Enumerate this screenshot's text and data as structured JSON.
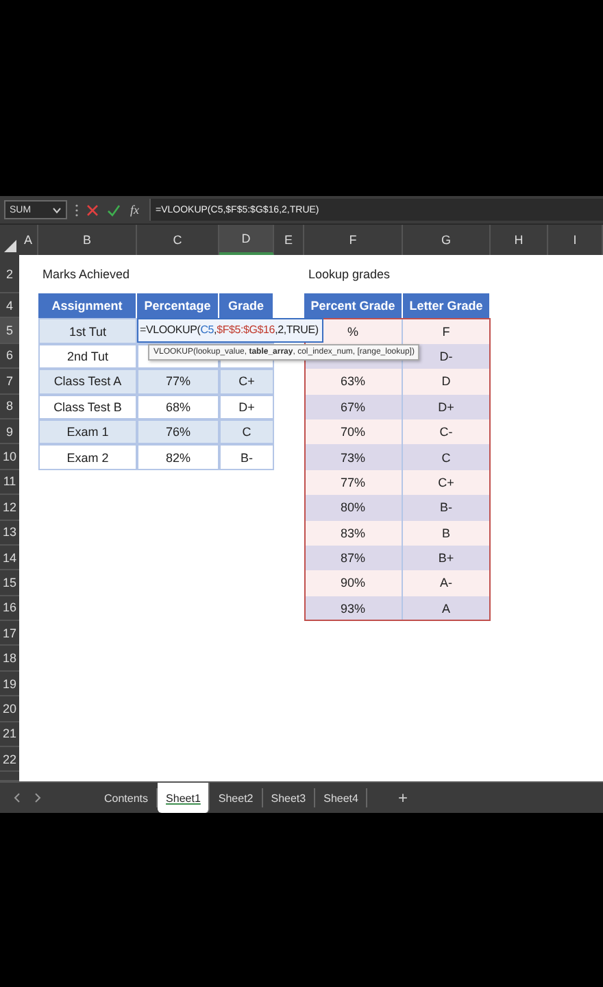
{
  "formula_bar": {
    "name_box": "SUM",
    "function_label": "fx",
    "formula": "=VLOOKUP(C5,$F$5:$G$16,2,TRUE)"
  },
  "columns": [
    {
      "label": "A",
      "selected": false
    },
    {
      "label": "B",
      "selected": false
    },
    {
      "label": "C",
      "selected": false
    },
    {
      "label": "D",
      "selected": true
    },
    {
      "label": "E",
      "selected": false
    },
    {
      "label": "F",
      "selected": false
    },
    {
      "label": "G",
      "selected": false
    },
    {
      "label": "H",
      "selected": false
    },
    {
      "label": "I",
      "selected": false
    }
  ],
  "row_headers": [
    {
      "label": "2",
      "selected": false
    },
    {
      "label": "4",
      "selected": false
    },
    {
      "label": "5",
      "selected": true
    },
    {
      "label": "6",
      "selected": false
    },
    {
      "label": "7",
      "selected": false
    },
    {
      "label": "8",
      "selected": false
    },
    {
      "label": "9",
      "selected": false
    },
    {
      "label": "10",
      "selected": false
    },
    {
      "label": "11",
      "selected": false
    },
    {
      "label": "12",
      "selected": false
    },
    {
      "label": "13",
      "selected": false
    },
    {
      "label": "14",
      "selected": false
    },
    {
      "label": "15",
      "selected": false
    },
    {
      "label": "16",
      "selected": false
    },
    {
      "label": "17",
      "selected": false
    },
    {
      "label": "18",
      "selected": false
    },
    {
      "label": "19",
      "selected": false
    },
    {
      "label": "20",
      "selected": false
    },
    {
      "label": "21",
      "selected": false
    },
    {
      "label": "22",
      "selected": false
    }
  ],
  "marks_table": {
    "title": "Marks Achieved",
    "headers": [
      "Assignment",
      "Percentage",
      "Grade"
    ],
    "rows": [
      {
        "assignment": "1st Tut"
      },
      {
        "assignment": "2nd Tut"
      },
      {
        "assignment": "Class Test A",
        "percentage": "77%",
        "grade": "C+"
      },
      {
        "assignment": "Class Test B",
        "percentage": "68%",
        "grade": "D+"
      },
      {
        "assignment": "Exam 1",
        "percentage": "76%",
        "grade": "C"
      },
      {
        "assignment": "Exam 2",
        "percentage": "82%",
        "grade": "B-"
      }
    ]
  },
  "lookup_table": {
    "title": "Lookup grades",
    "headers": [
      "Percent Grade",
      "Letter Grade"
    ],
    "referenced": true,
    "rows": [
      {
        "percent": "%",
        "letter": "F"
      },
      {
        "letter": "D-"
      },
      {
        "percent": "63%",
        "letter": "D"
      },
      {
        "percent": "67%",
        "letter": "D+"
      },
      {
        "percent": "70%",
        "letter": "C-"
      },
      {
        "percent": "73%",
        "letter": "C"
      },
      {
        "percent": "77%",
        "letter": "C+"
      },
      {
        "percent": "80%",
        "letter": "B-"
      },
      {
        "percent": "83%",
        "letter": "B"
      },
      {
        "percent": "87%",
        "letter": "B+"
      },
      {
        "percent": "90%",
        "letter": "A-"
      },
      {
        "percent": "93%",
        "letter": "A"
      }
    ]
  },
  "cell_editor": {
    "parts": [
      {
        "text": "=VLOOKUP("
      },
      {
        "text": "C5",
        "color": "#2f6fc4",
        "after": ","
      },
      {
        "text": "$F$5:$G$16",
        "color": "#c0392b"
      },
      {
        "text": ",2,TRUE)"
      }
    ],
    "tooltip": "VLOOKUP(lookup_value, **table_array**, col_index_num, [range_lookup])"
  },
  "sheet_tabs": [
    {
      "label": "Contents",
      "selected": false
    },
    {
      "label": "Sheet1",
      "selected": true
    },
    {
      "label": "Sheet2",
      "selected": false
    },
    {
      "label": "Sheet3",
      "selected": false
    },
    {
      "label": "Sheet4",
      "selected": false
    }
  ],
  "add_sheet": "+"
}
